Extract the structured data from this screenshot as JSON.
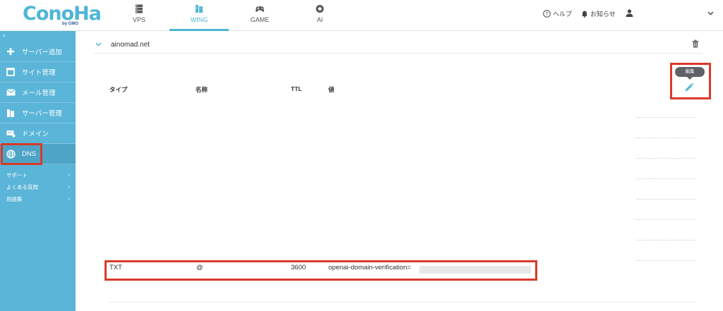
{
  "logo": {
    "text": "ConoHa",
    "sub": "by GMO"
  },
  "nav": {
    "tabs": [
      {
        "label": "VPS",
        "icon": "server-icon"
      },
      {
        "label": "WING",
        "icon": "wing-icon",
        "active": true
      },
      {
        "label": "GAME",
        "icon": "gamepad-icon"
      },
      {
        "label": "AI",
        "icon": "ai-icon"
      }
    ]
  },
  "header_right": {
    "help": "ヘルプ",
    "notifications": "お知らせ"
  },
  "sidebar": {
    "items": [
      {
        "label": "サーバー追加",
        "icon": "plus-icon"
      },
      {
        "label": "サイト管理",
        "icon": "site-icon"
      },
      {
        "label": "メール管理",
        "icon": "mail-icon"
      },
      {
        "label": "サーバー管理",
        "icon": "server-manage-icon"
      },
      {
        "label": "ドメイン",
        "icon": "domain-icon"
      },
      {
        "label": "DNS",
        "icon": "globe-icon",
        "active": true
      }
    ],
    "links": [
      {
        "label": "サポート"
      },
      {
        "label": "よくある質問"
      },
      {
        "label": "用語集"
      }
    ]
  },
  "main": {
    "domain": "ainomad.net",
    "columns": {
      "type": "タイプ",
      "name": "名称",
      "ttl": "TTL",
      "value": "値"
    },
    "edit_tooltip": "編集",
    "record": {
      "type": "TXT",
      "name": "@",
      "ttl": "3600",
      "value": "openai-domain-verification="
    }
  },
  "colors": {
    "accent": "#4fb6d6",
    "sidebar": "#5ab5d8",
    "highlight": "#d93a2a"
  }
}
